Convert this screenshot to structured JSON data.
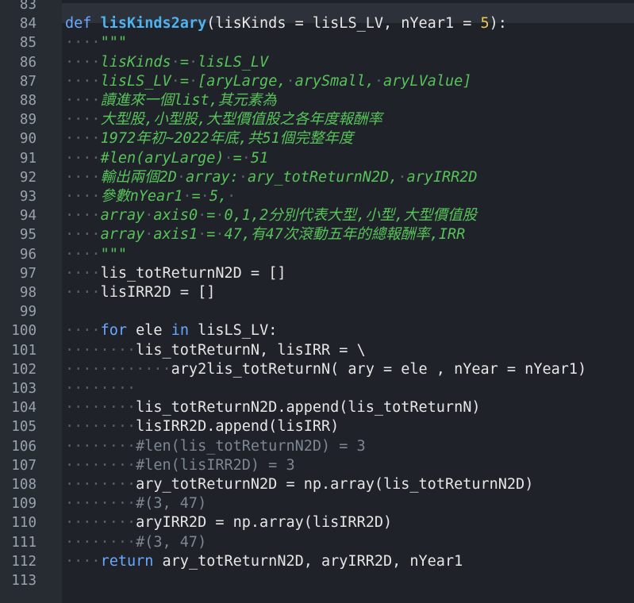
{
  "editor": {
    "lines": [
      {
        "no": "83",
        "segs": []
      },
      {
        "no": "84",
        "segs": [
          [
            "kw",
            "def "
          ],
          [
            "fn",
            "lisKinds2ary"
          ],
          [
            "t",
            "(lisKinds "
          ],
          [
            "op",
            "="
          ],
          [
            "t",
            " lisLS_LV, nYear1 "
          ],
          [
            "op",
            "="
          ],
          [
            "t",
            " "
          ],
          [
            "num",
            "5"
          ],
          [
            "t",
            "):"
          ]
        ]
      },
      {
        "no": "85",
        "segs": [
          [
            "ws",
            "····"
          ],
          [
            "doc",
            "\"\"\""
          ]
        ]
      },
      {
        "no": "86",
        "segs": [
          [
            "ws",
            "····"
          ],
          [
            "doc",
            "lisKinds"
          ],
          [
            "ws",
            "·"
          ],
          [
            "doc",
            "="
          ],
          [
            "ws",
            "·"
          ],
          [
            "doc",
            "lisLS_LV"
          ]
        ]
      },
      {
        "no": "87",
        "segs": [
          [
            "ws",
            "····"
          ],
          [
            "doc",
            "lisLS_LV"
          ],
          [
            "ws",
            "·"
          ],
          [
            "doc",
            "="
          ],
          [
            "ws",
            "·"
          ],
          [
            "doc",
            "[aryLarge,"
          ],
          [
            "ws",
            "·"
          ],
          [
            "doc",
            "arySmall,"
          ],
          [
            "ws",
            "·"
          ],
          [
            "doc",
            "aryLValue]"
          ]
        ]
      },
      {
        "no": "88",
        "segs": [
          [
            "ws",
            "····"
          ],
          [
            "doc",
            "讀進來一個list,其元素為"
          ]
        ]
      },
      {
        "no": "89",
        "segs": [
          [
            "ws",
            "····"
          ],
          [
            "doc",
            "大型股,小型股,大型價值股之各年度報酬率"
          ]
        ]
      },
      {
        "no": "90",
        "segs": [
          [
            "ws",
            "····"
          ],
          [
            "doc",
            "1972年初~2022年底,共51個完整年度"
          ]
        ]
      },
      {
        "no": "91",
        "segs": [
          [
            "ws",
            "····"
          ],
          [
            "doc",
            "#len(aryLarge)"
          ],
          [
            "ws",
            "·"
          ],
          [
            "doc",
            "="
          ],
          [
            "ws",
            "·"
          ],
          [
            "doc",
            "51"
          ]
        ]
      },
      {
        "no": "92",
        "segs": [
          [
            "ws",
            "····"
          ],
          [
            "doc",
            "輸出兩個2D"
          ],
          [
            "ws",
            "·"
          ],
          [
            "doc",
            "array:"
          ],
          [
            "ws",
            "·"
          ],
          [
            "doc",
            "ary_totReturnN2D,"
          ],
          [
            "ws",
            "·"
          ],
          [
            "doc",
            "aryIRR2D"
          ]
        ]
      },
      {
        "no": "93",
        "segs": [
          [
            "ws",
            "····"
          ],
          [
            "doc",
            "參數nYear1"
          ],
          [
            "ws",
            "·"
          ],
          [
            "doc",
            "="
          ],
          [
            "ws",
            "·"
          ],
          [
            "doc",
            "5,"
          ],
          [
            "ws",
            "·"
          ]
        ]
      },
      {
        "no": "94",
        "segs": [
          [
            "ws",
            "····"
          ],
          [
            "doc",
            "array"
          ],
          [
            "ws",
            "·"
          ],
          [
            "doc",
            "axis0"
          ],
          [
            "ws",
            "·"
          ],
          [
            "doc",
            "="
          ],
          [
            "ws",
            "·"
          ],
          [
            "doc",
            "0,1,2分別代表大型,小型,大型價值股"
          ]
        ]
      },
      {
        "no": "95",
        "segs": [
          [
            "ws",
            "····"
          ],
          [
            "doc",
            "array"
          ],
          [
            "ws",
            "·"
          ],
          [
            "doc",
            "axis1"
          ],
          [
            "ws",
            "·"
          ],
          [
            "doc",
            "="
          ],
          [
            "ws",
            "·"
          ],
          [
            "doc",
            "47,有47次滾動五年的總報酬率,IRR"
          ]
        ]
      },
      {
        "no": "96",
        "segs": [
          [
            "ws",
            "····"
          ],
          [
            "doc",
            "\"\"\""
          ]
        ]
      },
      {
        "no": "97",
        "segs": [
          [
            "ws",
            "····"
          ],
          [
            "t",
            "lis_totReturnN2D "
          ],
          [
            "op",
            "="
          ],
          [
            "t",
            " [] "
          ]
        ]
      },
      {
        "no": "98",
        "segs": [
          [
            "ws",
            "····"
          ],
          [
            "t",
            "lisIRR2D "
          ],
          [
            "op",
            "="
          ],
          [
            "t",
            " []"
          ]
        ]
      },
      {
        "no": "99",
        "segs": []
      },
      {
        "no": "100",
        "segs": [
          [
            "ws",
            "····"
          ],
          [
            "kw",
            "for"
          ],
          [
            "t",
            " ele "
          ],
          [
            "kw",
            "in"
          ],
          [
            "t",
            " lisLS_LV:"
          ]
        ]
      },
      {
        "no": "101",
        "segs": [
          [
            "ws",
            "········"
          ],
          [
            "t",
            "lis_totReturnN, lisIRR "
          ],
          [
            "op",
            "="
          ],
          [
            "t",
            " \\"
          ]
        ]
      },
      {
        "no": "102",
        "segs": [
          [
            "ws",
            "············"
          ],
          [
            "t",
            "ary2lis_totReturnN( ary "
          ],
          [
            "op",
            "="
          ],
          [
            "t",
            " ele , nYear "
          ],
          [
            "op",
            "="
          ],
          [
            "t",
            " nYear1)"
          ]
        ]
      },
      {
        "no": "103",
        "segs": [
          [
            "ws",
            "········"
          ]
        ]
      },
      {
        "no": "104",
        "segs": [
          [
            "ws",
            "········"
          ],
          [
            "t",
            "lis_totReturnN2D.append(lis_totReturnN)"
          ]
        ]
      },
      {
        "no": "105",
        "segs": [
          [
            "ws",
            "········"
          ],
          [
            "t",
            "lisIRR2D.append(lisIRR)"
          ]
        ]
      },
      {
        "no": "106",
        "segs": [
          [
            "ws",
            "········"
          ],
          [
            "cmt",
            "#len(lis_totReturnN2D) = 3"
          ]
        ]
      },
      {
        "no": "107",
        "segs": [
          [
            "ws",
            "········"
          ],
          [
            "cmt",
            "#len(lisIRR2D) = 3"
          ]
        ]
      },
      {
        "no": "108",
        "segs": [
          [
            "ws",
            "········"
          ],
          [
            "t",
            "ary_totReturnN2D "
          ],
          [
            "op",
            "="
          ],
          [
            "t",
            " np.array(lis_totReturnN2D)"
          ]
        ]
      },
      {
        "no": "109",
        "segs": [
          [
            "ws",
            "········"
          ],
          [
            "cmt",
            "#(3, 47)"
          ]
        ]
      },
      {
        "no": "110",
        "segs": [
          [
            "ws",
            "········"
          ],
          [
            "t",
            "aryIRR2D "
          ],
          [
            "op",
            "="
          ],
          [
            "t",
            " np.array(lisIRR2D)"
          ]
        ]
      },
      {
        "no": "111",
        "segs": [
          [
            "ws",
            "········"
          ],
          [
            "cmt",
            "#(3, 47)"
          ]
        ]
      },
      {
        "no": "112",
        "segs": [
          [
            "ws",
            "····"
          ],
          [
            "kw",
            "return"
          ],
          [
            "t",
            " ary_totReturnN2D, aryIRR2D, nYear1"
          ]
        ]
      },
      {
        "no": "113",
        "segs": []
      }
    ]
  }
}
